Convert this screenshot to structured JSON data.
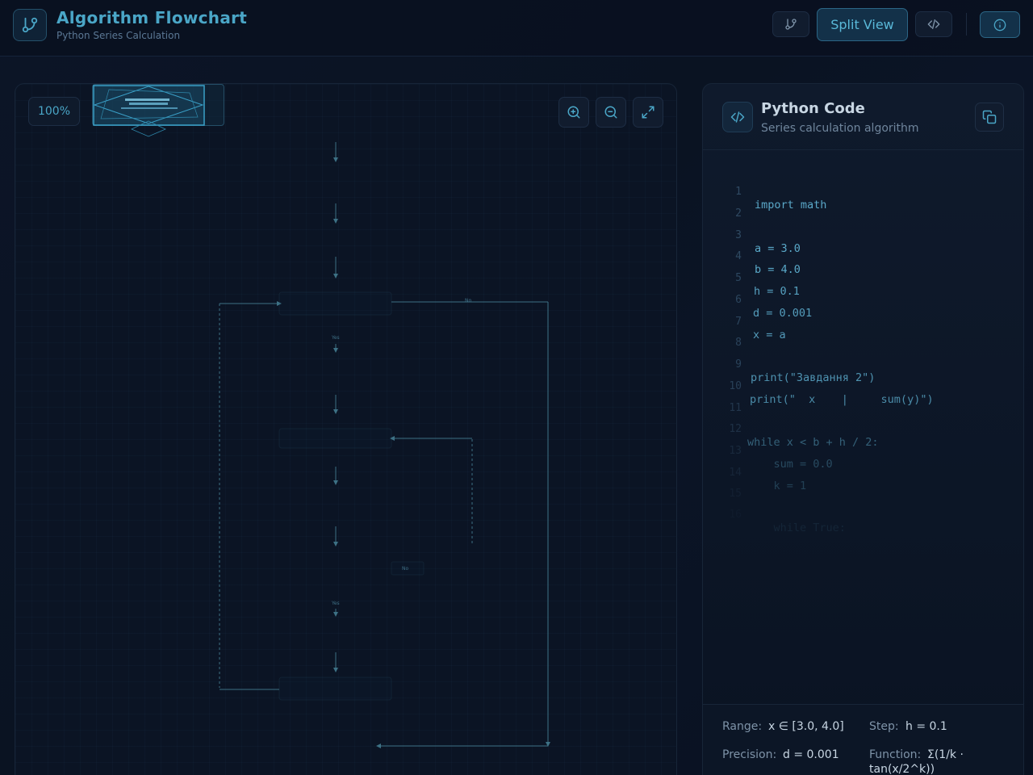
{
  "header": {
    "title": "Algorithm Flowchart",
    "subtitle": "Python Series Calculation",
    "split_view_label": "Split View"
  },
  "colors": {
    "accent": "#4aa6c7",
    "background": "#0b1220",
    "flow_line": "#3d7185"
  },
  "flowchart": {
    "zoom_level": "100%",
    "labels": {
      "no_1": "No",
      "yes_1": "Yes",
      "no_2": "No",
      "yes_2": "Yes"
    }
  },
  "code_panel": {
    "title": "Python Code",
    "subtitle": "Series calculation algorithm",
    "lines": [
      {
        "n": "1",
        "text": "import math"
      },
      {
        "n": "2",
        "text": ""
      },
      {
        "n": "3",
        "text": "a = 3.0"
      },
      {
        "n": "4",
        "text": "b = 4.0"
      },
      {
        "n": "5",
        "text": "h = 0.1"
      },
      {
        "n": "6",
        "text": "d = 0.001"
      },
      {
        "n": "7",
        "text": "x = a"
      },
      {
        "n": "8",
        "text": ""
      },
      {
        "n": "9",
        "text": "print(\"Завдання 2\")"
      },
      {
        "n": "10",
        "text": "print(\"  x    |     sum(y)\")"
      },
      {
        "n": "11",
        "text": ""
      },
      {
        "n": "12",
        "text": "while x < b + h / 2:"
      },
      {
        "n": "13",
        "text": "    sum = 0.0"
      },
      {
        "n": "14",
        "text": "    k = 1"
      },
      {
        "n": "15",
        "text": ""
      },
      {
        "n": "16",
        "text": "    while True:"
      }
    ],
    "info": {
      "range_label": "Range:",
      "range_value": "x ∈ [3.0, 4.0]",
      "step_label": "Step:",
      "step_value": "h = 0.1",
      "precision_label": "Precision:",
      "precision_value": "d = 0.001",
      "function_label": "Function:",
      "function_value_1": "Σ(1/k ·",
      "function_value_2": "tan(x/2^k))"
    }
  },
  "icons": {
    "logo": "git-branch-icon",
    "branch_button": "git-branch-icon",
    "code_button": "code-icon",
    "info_button": "info-icon",
    "zoom_in": "zoom-in-icon",
    "zoom_out": "zoom-out-icon",
    "fit": "expand-icon",
    "copy": "copy-icon"
  }
}
